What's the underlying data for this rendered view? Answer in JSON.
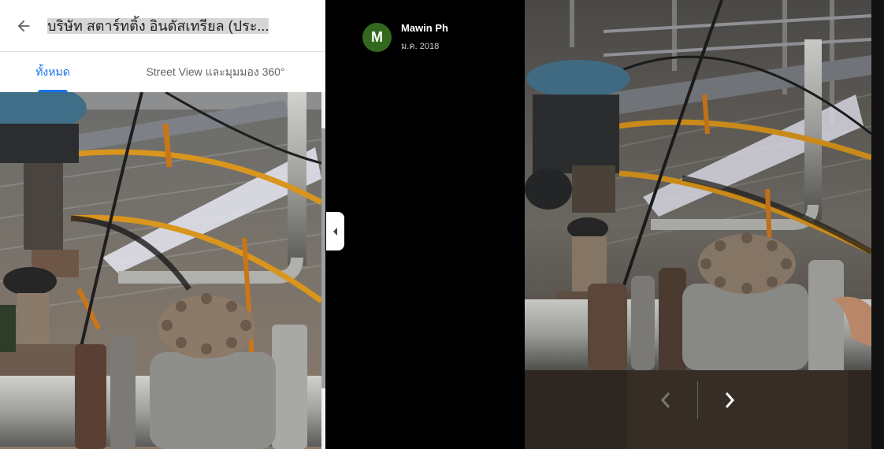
{
  "header": {
    "title": "บริษัท สตาร์ทติ้ง อินดัสเทรียล (ประ..."
  },
  "tabs": [
    {
      "label": "ทั้งหมด",
      "active": true
    },
    {
      "label": "Street View และมุมมอง 360°",
      "active": false
    }
  ],
  "author": {
    "initial": "M",
    "name": "Mawin Ph",
    "date": "ม.ค. 2018",
    "avatar_color": "#33691e"
  },
  "colors": {
    "accent": "#1a73e8"
  },
  "icons": {
    "back": "arrow-left-icon",
    "collapse": "chevron-left-icon",
    "prev": "chevron-left-icon",
    "next": "chevron-right-icon"
  }
}
